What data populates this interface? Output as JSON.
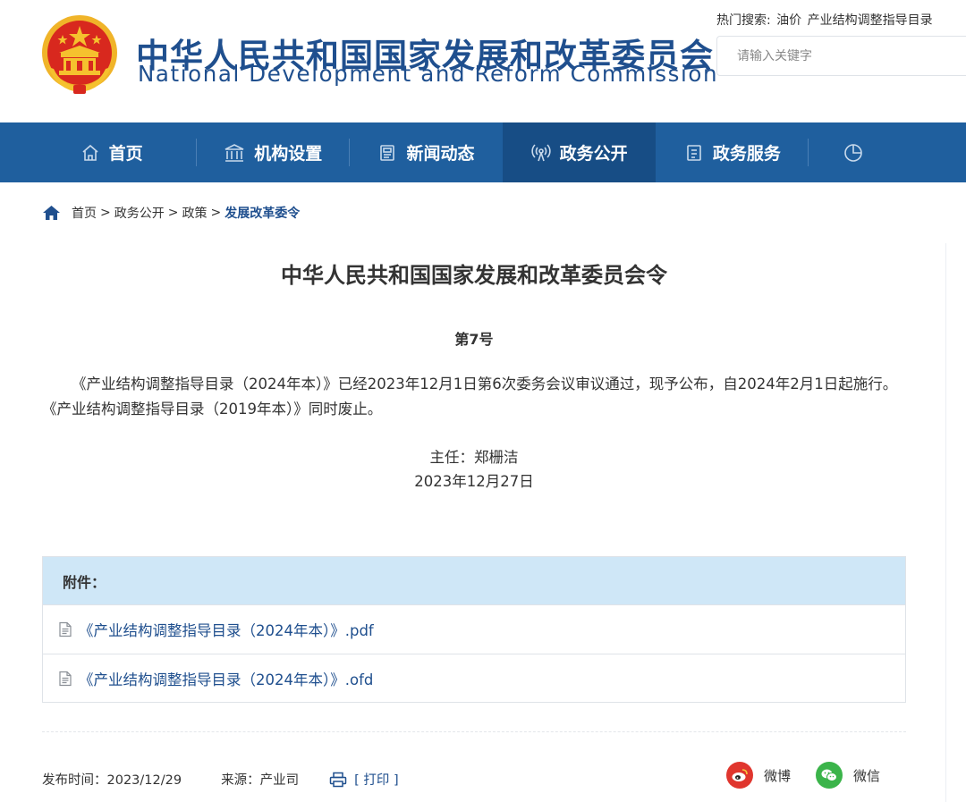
{
  "header": {
    "title_cn": "中华人民共和国国家发展和改革委员会",
    "title_en": "National Development and Reform Commission",
    "hot_search_label": "热门搜索:",
    "hot_search_items": [
      "油价",
      "产业结构调整指导目录"
    ],
    "search_placeholder": "请输入关键字"
  },
  "nav": {
    "items": [
      {
        "label": "首页",
        "icon": "home-icon"
      },
      {
        "label": "机构设置",
        "icon": "building-icon"
      },
      {
        "label": "新闻动态",
        "icon": "news-icon"
      },
      {
        "label": "政务公开",
        "icon": "broadcast-icon",
        "active": true
      },
      {
        "label": "政务服务",
        "icon": "document-icon"
      },
      {
        "label": "",
        "icon": "pie-chart-icon"
      }
    ]
  },
  "breadcrumb": {
    "items": [
      "首页",
      "政务公开",
      "政策"
    ],
    "separator": ">",
    "current": "发展改革委令"
  },
  "article": {
    "title": "中华人民共和国国家发展和改革委员会令",
    "number": "第7号",
    "body": "《产业结构调整指导目录（2024年本）》已经2023年12月1日第6次委务会议审议通过，现予公布，自2024年2月1日起施行。《产业结构调整指导目录（2019年本）》同时废止。",
    "signatory": "主任：郑栅洁",
    "date": "2023年12月27日"
  },
  "attachments": {
    "label": "附件：",
    "files": [
      "《产业结构调整指导目录（2024年本）》.pdf",
      "《产业结构调整指导目录（2024年本）》.ofd"
    ]
  },
  "meta": {
    "publish_time": "发布时间：2023/12/29",
    "source": "来源：产业司",
    "print": "[ 打印 ]"
  },
  "share": {
    "weibo": "微博",
    "wechat": "微信"
  },
  "colors": {
    "brand_blue": "#1f5f9e",
    "title_blue": "#1f4f8e",
    "attach_header_bg": "#cfe7f7",
    "emblem_red": "#d8281e",
    "emblem_gold": "#f5c12e"
  }
}
